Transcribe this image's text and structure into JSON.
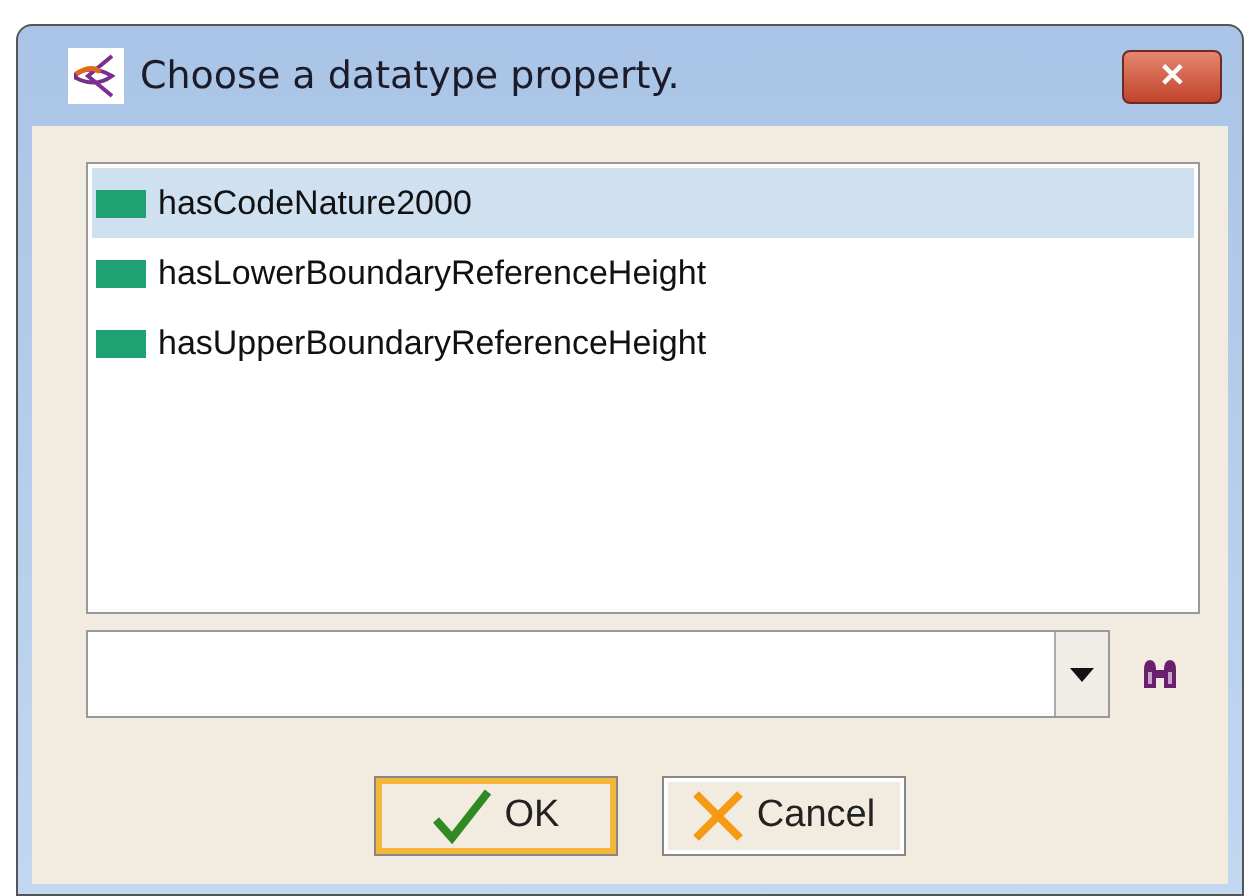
{
  "window": {
    "title": "Choose a datatype property.",
    "close": "✕"
  },
  "list": {
    "items": [
      {
        "label": "hasCodeNature2000",
        "selected": true
      },
      {
        "label": "hasLowerBoundaryReferenceHeight",
        "selected": false
      },
      {
        "label": "hasUpperBoundaryReferenceHeight",
        "selected": false
      }
    ]
  },
  "buttons": [
    {
      "kind": "ok",
      "label": "OK",
      "focused": true
    },
    {
      "kind": "cancel",
      "label": "Cancel",
      "focused": false
    }
  ]
}
